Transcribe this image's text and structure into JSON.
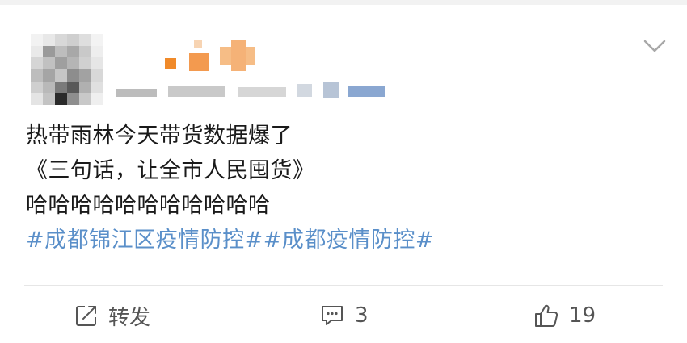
{
  "post": {
    "lines": [
      "热带雨林今天带货数据爆了",
      "《三句话，让全市人民囤货》",
      "哈哈哈哈哈哈哈哈哈哈哈"
    ],
    "hashtags": [
      "#成都锦江区疫情防控#",
      "#成都疫情防控#"
    ]
  },
  "actions": {
    "repost": {
      "icon": "share-square-icon",
      "label": "转发"
    },
    "comment": {
      "icon": "comment-bubble-icon",
      "count": "3"
    },
    "like": {
      "icon": "thumbs-up-icon",
      "count": "19"
    }
  },
  "header": {
    "menu_icon": "chevron-down-icon",
    "accent": "#5a8fc9",
    "name_blur_colors": [
      "#f08a2a",
      "#f4b27a"
    ]
  }
}
